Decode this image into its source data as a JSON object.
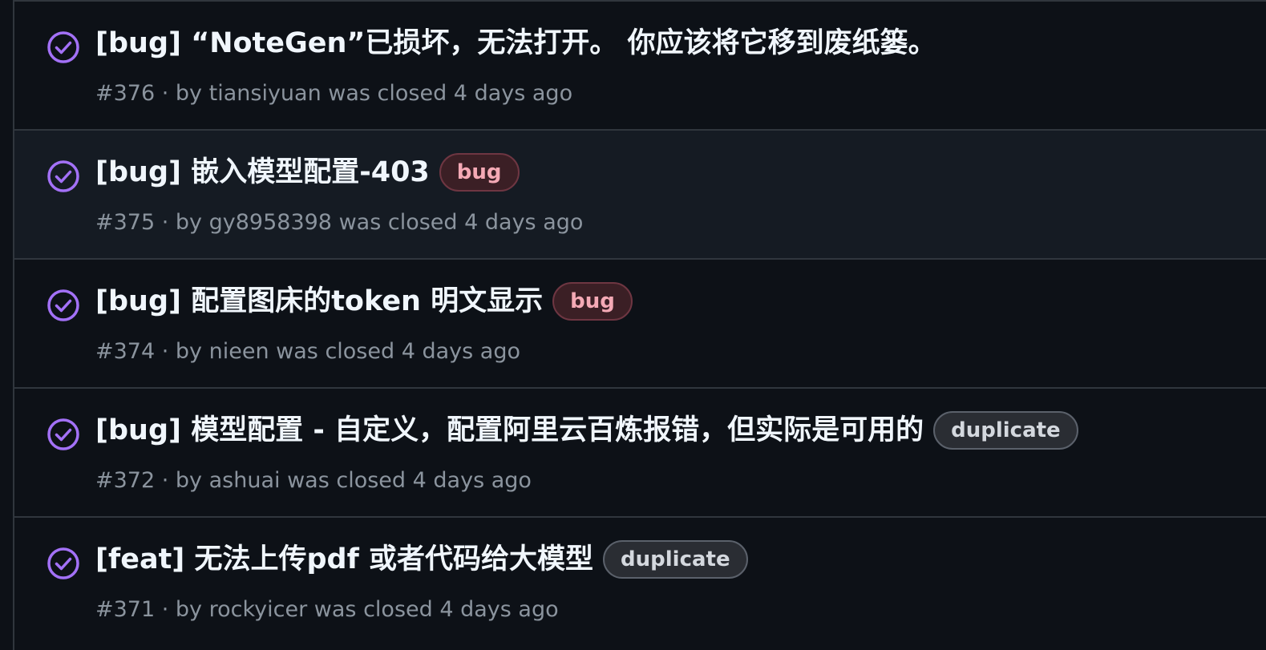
{
  "issues": [
    {
      "title": "[bug] “NoteGen”已损坏，无法打开。 你应该将它移到废纸篓。",
      "label": "",
      "label_type": "",
      "number": "#376",
      "by_prefix": " · by ",
      "author": "tiansiyuan",
      "status_text": " was closed 4 days ago",
      "icon": "closed-check-icon",
      "hover": false
    },
    {
      "title": "[bug] 嵌入模型配置-403",
      "label": "bug",
      "label_type": "bug",
      "number": "#375",
      "by_prefix": " · by ",
      "author": "gy8958398",
      "status_text": " was closed 4 days ago",
      "icon": "closed-check-icon",
      "hover": true
    },
    {
      "title": "[bug] 配置图床的token 明文显示",
      "label": "bug",
      "label_type": "bug",
      "number": "#374",
      "by_prefix": " · by ",
      "author": "nieen",
      "status_text": " was closed 4 days ago",
      "icon": "closed-check-icon",
      "hover": false
    },
    {
      "title": "[bug] 模型配置 - 自定义，配置阿里云百炼报错，但实际是可用的",
      "label": "duplicate",
      "label_type": "duplicate",
      "number": "#372",
      "by_prefix": " · by ",
      "author": "ashuai",
      "status_text": " was closed 4 days ago",
      "icon": "closed-check-icon",
      "hover": false
    },
    {
      "title": "[feat] 无法上传pdf 或者代码给大模型",
      "label": "duplicate",
      "label_type": "duplicate",
      "number": "#371",
      "by_prefix": " · by ",
      "author": "rockyicer",
      "status_text": " was closed 4 days ago",
      "icon": "closed-check-icon",
      "hover": false
    }
  ],
  "colors": {
    "background": "#0d1117",
    "row_hover": "#151b23",
    "border": "#30363d",
    "closed_icon": "#a371f7",
    "title": "#f0f6fc",
    "meta": "#8b949e"
  }
}
